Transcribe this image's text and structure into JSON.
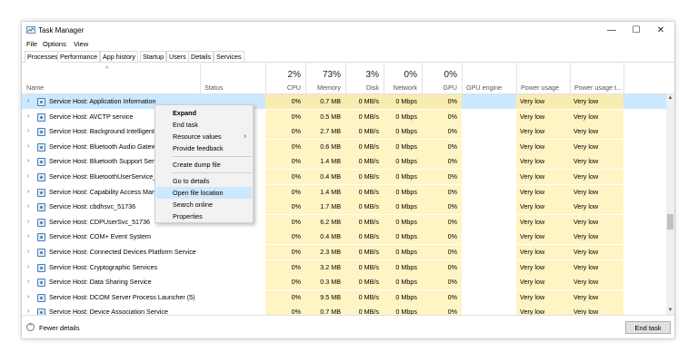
{
  "window": {
    "title": "Task Manager",
    "minimize": "—",
    "maximize": "☐",
    "close": "✕"
  },
  "menu": [
    "File",
    "Options",
    "View"
  ],
  "tabs": [
    "Processes",
    "Performance",
    "App history",
    "Startup",
    "Users",
    "Details",
    "Services"
  ],
  "active_tab": "Processes",
  "columns": {
    "name": "Name",
    "status": "Status",
    "cpu": {
      "pct": "2%",
      "label": "CPU"
    },
    "memory": {
      "pct": "73%",
      "label": "Memory"
    },
    "disk": {
      "pct": "3%",
      "label": "Disk"
    },
    "network": {
      "pct": "0%",
      "label": "Network"
    },
    "gpu": {
      "pct": "0%",
      "label": "GPU"
    },
    "gpu_engine": "GPU engine",
    "power_usage": "Power usage",
    "power_usage_trend": "Power usage t..."
  },
  "processes": [
    {
      "name": "Service Host: Application Information",
      "cpu": "0%",
      "memory": "0.7 MB",
      "disk": "0 MB/s",
      "network": "0 Mbps",
      "gpu": "0%",
      "power": "Very low",
      "power_trend": "Very low",
      "selected": true
    },
    {
      "name": "Service Host: AVCTP service",
      "cpu": "0%",
      "memory": "0.5 MB",
      "disk": "0 MB/s",
      "network": "0 Mbps",
      "gpu": "0%",
      "power": "Very low",
      "power_trend": "Very low"
    },
    {
      "name": "Service Host: Background Intelligent",
      "cpu": "0%",
      "memory": "2.7 MB",
      "disk": "0 MB/s",
      "network": "0 Mbps",
      "gpu": "0%",
      "power": "Very low",
      "power_trend": "Very low"
    },
    {
      "name": "Service Host: Bluetooth Audio Gatew",
      "cpu": "0%",
      "memory": "0.6 MB",
      "disk": "0 MB/s",
      "network": "0 Mbps",
      "gpu": "0%",
      "power": "Very low",
      "power_trend": "Very low"
    },
    {
      "name": "Service Host: Bluetooth Support Serv",
      "cpu": "0%",
      "memory": "1.4 MB",
      "disk": "0 MB/s",
      "network": "0 Mbps",
      "gpu": "0%",
      "power": "Very low",
      "power_trend": "Very low"
    },
    {
      "name": "Service Host: BluetoothUserService_5",
      "cpu": "0%",
      "memory": "0.4 MB",
      "disk": "0 MB/s",
      "network": "0 Mbps",
      "gpu": "0%",
      "power": "Very low",
      "power_trend": "Very low"
    },
    {
      "name": "Service Host: Capability Access Mana",
      "cpu": "0%",
      "memory": "1.4 MB",
      "disk": "0 MB/s",
      "network": "0 Mbps",
      "gpu": "0%",
      "power": "Very low",
      "power_trend": "Very low"
    },
    {
      "name": "Service Host: cbdhsvc_51736",
      "cpu": "0%",
      "memory": "1.7 MB",
      "disk": "0 MB/s",
      "network": "0 Mbps",
      "gpu": "0%",
      "power": "Very low",
      "power_trend": "Very low"
    },
    {
      "name": "Service Host: CDPUserSvc_51736",
      "cpu": "0%",
      "memory": "6.2 MB",
      "disk": "0 MB/s",
      "network": "0 Mbps",
      "gpu": "0%",
      "power": "Very low",
      "power_trend": "Very low"
    },
    {
      "name": "Service Host: COM+ Event System",
      "cpu": "0%",
      "memory": "0.4 MB",
      "disk": "0 MB/s",
      "network": "0 Mbps",
      "gpu": "0%",
      "power": "Very low",
      "power_trend": "Very low"
    },
    {
      "name": "Service Host: Connected Devices Platform Service",
      "cpu": "0%",
      "memory": "2.3 MB",
      "disk": "0 MB/s",
      "network": "0 Mbps",
      "gpu": "0%",
      "power": "Very low",
      "power_trend": "Very low"
    },
    {
      "name": "Service Host: Cryptographic Services",
      "cpu": "0%",
      "memory": "3.2 MB",
      "disk": "0 MB/s",
      "network": "0 Mbps",
      "gpu": "0%",
      "power": "Very low",
      "power_trend": "Very low"
    },
    {
      "name": "Service Host: Data Sharing Service",
      "cpu": "0%",
      "memory": "0.3 MB",
      "disk": "0 MB/s",
      "network": "0 Mbps",
      "gpu": "0%",
      "power": "Very low",
      "power_trend": "Very low"
    },
    {
      "name": "Service Host: DCOM Server Process Launcher (5)",
      "cpu": "0%",
      "memory": "9.5 MB",
      "disk": "0 MB/s",
      "network": "0 Mbps",
      "gpu": "0%",
      "power": "Very low",
      "power_trend": "Very low"
    },
    {
      "name": "Service Host: Device Association Service",
      "cpu": "0%",
      "memory": "0.7 MB",
      "disk": "0 MB/s",
      "network": "0 Mbps",
      "gpu": "0%",
      "power": "Very low",
      "power_trend": "Very low"
    }
  ],
  "context_menu": [
    {
      "label": "Expand",
      "bold": true
    },
    {
      "label": "End task"
    },
    {
      "label": "Resource values",
      "submenu": true
    },
    {
      "label": "Provide feedback"
    },
    {
      "separator": true
    },
    {
      "label": "Create dump file"
    },
    {
      "separator": true
    },
    {
      "label": "Go to details"
    },
    {
      "label": "Open file location",
      "highlight": true
    },
    {
      "label": "Search online"
    },
    {
      "label": "Properties"
    }
  ],
  "footer": {
    "fewer_details": "Fewer details",
    "end_task": "End task"
  },
  "colors": {
    "selected_row": "#cce8ff",
    "heat_light": "#fff4c4",
    "accent": "#4a7fb5"
  }
}
